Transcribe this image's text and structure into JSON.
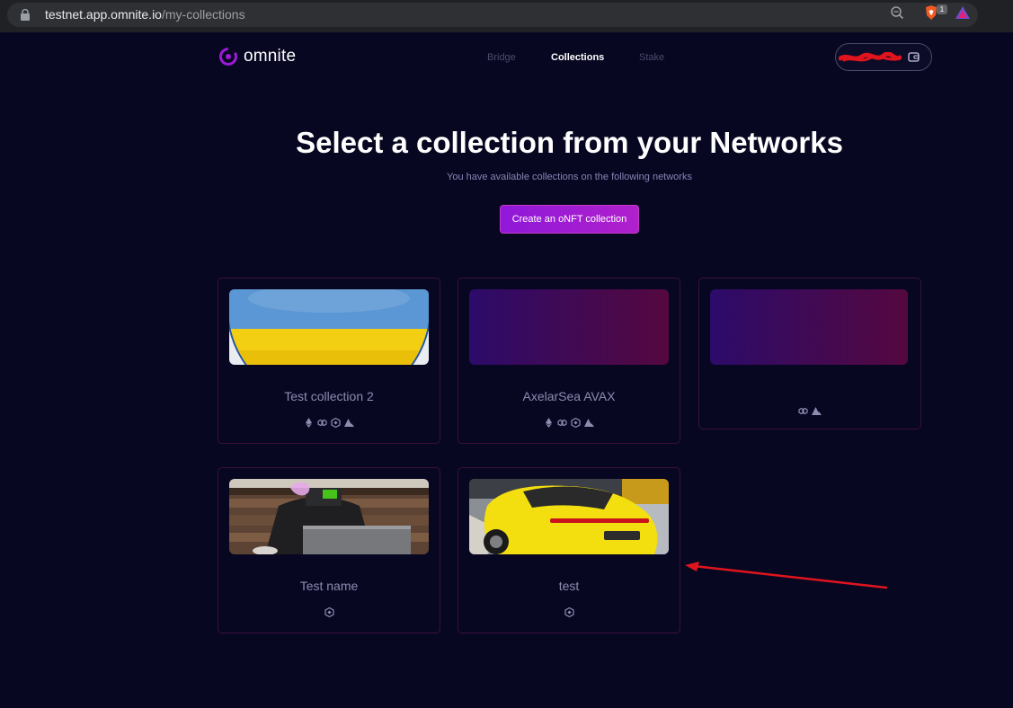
{
  "browser": {
    "url_host": "testnet.app.omnite.io",
    "url_path": "/my-collections",
    "brave_badge": "1"
  },
  "header": {
    "logo_text": "omnite",
    "nav": [
      {
        "label": "Bridge",
        "active": false
      },
      {
        "label": "Collections",
        "active": true
      },
      {
        "label": "Stake",
        "active": false
      }
    ]
  },
  "hero": {
    "title": "Select a collection from your Networks",
    "subtitle": "You have available collections on the following networks",
    "create_button": "Create an oNFT collection"
  },
  "collections": [
    {
      "name": "Test collection 2",
      "image": "ukraine-flag-button",
      "networks": [
        "ethereum-icon",
        "polygon-icon",
        "bnb-icon",
        "avalanche-icon"
      ]
    },
    {
      "name": "AxelarSea AVAX",
      "image": "purple-gradient",
      "networks": [
        "ethereum-icon",
        "polygon-icon",
        "bnb-icon",
        "avalanche-icon"
      ]
    },
    {
      "name": "",
      "image": "purple-gradient",
      "networks": [
        "polygon-icon",
        "avalanche-icon"
      ]
    },
    {
      "name": "Test name",
      "image": "person-with-laptop-photo",
      "networks": [
        "bnb-icon"
      ]
    },
    {
      "name": "test",
      "image": "yellow-sports-car-photo",
      "networks": [
        "bnb-icon"
      ]
    }
  ],
  "colors": {
    "background": "#080722",
    "accent": "#9b1bd6",
    "card_border": "#3a0f3d",
    "annotation": "#e0141c"
  }
}
